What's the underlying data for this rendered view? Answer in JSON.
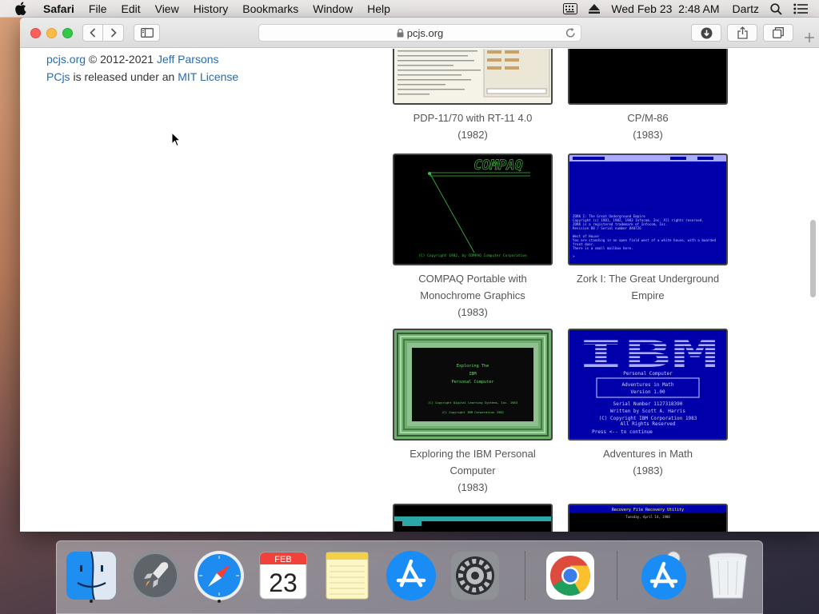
{
  "menubar": {
    "app": "Safari",
    "items": [
      "File",
      "Edit",
      "View",
      "History",
      "Bookmarks",
      "Window",
      "Help"
    ],
    "clock": "Wed Feb 23  2:48 AM",
    "user": "Dartz"
  },
  "toolbar": {
    "url": "pcjs.org"
  },
  "footer": {
    "site": "pcjs.org",
    "copyright": " © 2012-2021 ",
    "author": "Jeff Parsons",
    "project": "PCjs",
    "released": " is released under an ",
    "license": "MIT License"
  },
  "tiles": [
    {
      "lines": [
        "PDP-11/70 with RT-11 4.0",
        "(1982)"
      ]
    },
    {
      "lines": [
        "CP/M-86",
        "(1983)"
      ]
    },
    {
      "lines": [
        "COMPAQ Portable with",
        "Monochrome Graphics",
        "(1983)"
      ]
    },
    {
      "lines": [
        "Zork I: The Great Underground",
        "Empire"
      ]
    },
    {
      "lines": [
        "Exploring the IBM Personal",
        "Computer",
        "(1983)"
      ]
    },
    {
      "lines": [
        "Adventures in Math",
        "(1983)"
      ]
    }
  ],
  "screens": {
    "compaq": {
      "logo": "COMPAQ",
      "footer": "(C) Copyright 1982, by COMPAQ Computer Corporation"
    },
    "zork": {
      "lines": [
        "ZORK I: The Great Underground Empire",
        "Copyright (c) 1981, 1982, 1983 Infocom, Inc. All rights reserved.",
        "ZORK is a registered trademark of Infocom, Inc.",
        "Revision 88 / Serial number 840726",
        "",
        "West of House",
        "You are standing in an open field west of a white house, with a boarded",
        "front door.",
        "There is a small mailbox here.",
        ">"
      ]
    },
    "exploring": {
      "lines": [
        "Exploring  The",
        "IBM",
        "Personal  Computer",
        "",
        "(C) Copyright Digital Learning Systems, Inc. 1983",
        "(C) Copyright IBM Corporation 1982"
      ]
    },
    "math": {
      "logo": "IBM",
      "lines": [
        "Personal  Computer",
        "Adventures in Math",
        "Version 1.00",
        "Serial Number 1127318390",
        "Written by Scott A. Harris",
        "(C) Copyright IBM Corporation  1983",
        "All Rights Reserved",
        "Press <-- to continue"
      ]
    },
    "recovery": {
      "title": "Recovery File Recovery Utility",
      "date": "Tuesday, April 14, 1988"
    }
  },
  "dock": [
    "finder",
    "launchpad",
    "safari",
    "calendar",
    "notes",
    "app-store",
    "system-preferences",
    "chrome",
    "app-store-downloads",
    "trash"
  ],
  "calendar": {
    "month": "FEB",
    "day": "23"
  },
  "colors": {
    "link": "#2a6bab",
    "zork_blue": "#0000aa",
    "math_blue": "#0000aa",
    "compaq_green": "#3fbf3f"
  }
}
